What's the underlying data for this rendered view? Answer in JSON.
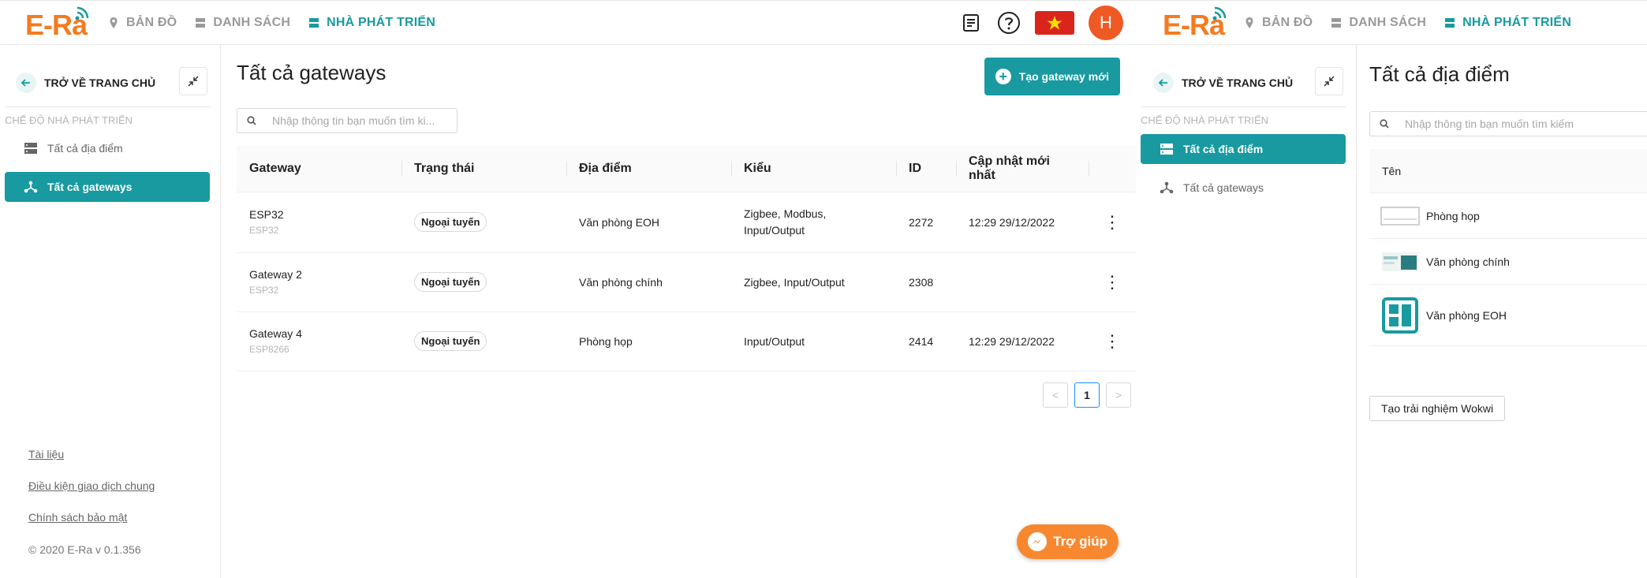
{
  "brand": {
    "logo_text": "E-Ra",
    "accent": "#189aa0",
    "logo_color": "#f47b20",
    "help_color": "#f7882f"
  },
  "nav": [
    {
      "label": "BẢN ĐỒ",
      "icon": "map-pin-icon",
      "active": false
    },
    {
      "label": "DANH SÁCH",
      "icon": "list-icon",
      "active": false
    },
    {
      "label": "NHÀ PHÁT TRIỂN",
      "icon": "developer-icon",
      "active": true
    }
  ],
  "header_actions": {
    "avatar_initial": "H"
  },
  "left": {
    "sidebar": {
      "back_label": "TRỞ VỀ TRANG CHỦ",
      "section_label": "CHẾ ĐỘ NHÀ PHÁT TRIỂN",
      "items": [
        {
          "label": "Tất cả địa điểm",
          "icon": "server-icon",
          "active": false
        },
        {
          "label": "Tất cả gateways",
          "icon": "share-nodes-icon",
          "active": true
        }
      ],
      "footer": {
        "docs": "Tài liệu",
        "terms": "Điều kiện giao dịch chung",
        "privacy": "Chính sách bảo mật",
        "copyright": "© 2020 E-Ra v 0.1.356"
      }
    },
    "main": {
      "title": "Tất cả gateways",
      "create_button": "Tạo gateway mới",
      "search_placeholder": "Nhập thông tin bạn muốn tìm ki...",
      "columns": [
        "Gateway",
        "Trạng thái",
        "Địa điểm",
        "Kiểu",
        "ID",
        "Cập nhật mới nhất"
      ],
      "rows": [
        {
          "name": "ESP32",
          "board": "ESP32",
          "status": "Ngoại tuyến",
          "location": "Văn phòng EOH",
          "type_line1": "Zigbee, Modbus,",
          "type_line2": "Input/Output",
          "id": "2272",
          "updated": "12:29 29/12/2022"
        },
        {
          "name": "Gateway 2",
          "board": "ESP32",
          "status": "Ngoại tuyến",
          "location": "Văn phòng chính",
          "type_line1": "Zigbee, Input/Output",
          "type_line2": "",
          "id": "2308",
          "updated": ""
        },
        {
          "name": "Gateway 4",
          "board": "ESP8266",
          "status": "Ngoại tuyến",
          "location": "Phòng họp",
          "type_line1": "Input/Output",
          "type_line2": "",
          "id": "2414",
          "updated": "12:29 29/12/2022"
        }
      ],
      "pagination": {
        "prev": "<",
        "current": "1",
        "next": ">"
      },
      "help_button": "Trợ giúp"
    }
  },
  "right": {
    "sidebar": {
      "back_label": "TRỞ VỀ TRANG CHỦ",
      "section_label": "CHẾ ĐỘ NHÀ PHÁT TRIỂN",
      "items": [
        {
          "label": "Tất cả địa điểm",
          "icon": "server-icon",
          "active": true
        },
        {
          "label": "Tất cả gateways",
          "icon": "share-nodes-icon",
          "active": false
        }
      ]
    },
    "main": {
      "title": "Tất cả địa điểm",
      "search_placeholder": "Nhập thông tin bạn muốn tìm kiếm",
      "column": "Tên",
      "rows": [
        {
          "name": "Phòng họp",
          "thumb": "meeting-room-thumb"
        },
        {
          "name": "Văn phòng chính",
          "thumb": "main-office-thumb"
        },
        {
          "name": "Văn phòng EOH",
          "thumb": "dashboard-icon"
        }
      ],
      "wokwi_button": "Tạo trải nghiệm Wokwi"
    }
  }
}
